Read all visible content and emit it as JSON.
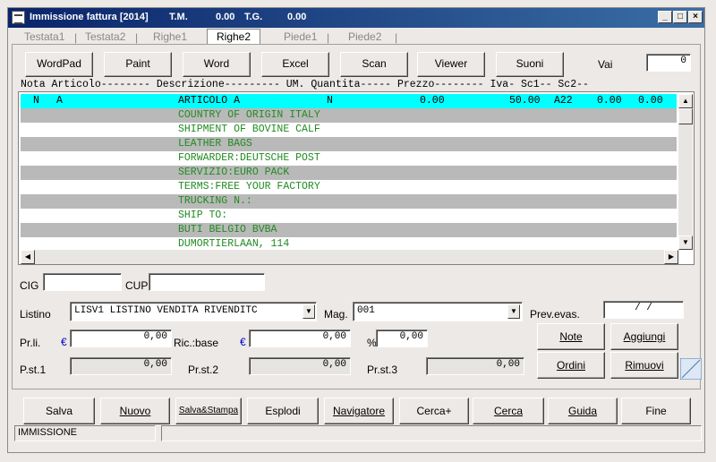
{
  "window": {
    "title_parts": [
      "Immissione fattura [2014]",
      "T.M.",
      "0.00",
      "T.G.",
      "0.00"
    ],
    "controls": {
      "minimize": "_",
      "maximize": "□",
      "close": "×"
    }
  },
  "tabs": [
    "Testata1",
    "Testata2",
    "Righe1",
    "Righe2",
    "Piede1",
    "Piede2"
  ],
  "active_tab": "Righe2",
  "toolbar": {
    "buttons": [
      "WordPad",
      "Paint",
      "Word",
      "Excel",
      "Scan",
      "Viewer",
      "Suoni"
    ],
    "vai_label": "Vai",
    "vai_value": "0"
  },
  "grid": {
    "header": "Nota Articolo-------- Descrizione--------- UM. Quantita----- Prezzo-------- Iva- Sc1-- Sc2--",
    "selected_row": {
      "nota": "N",
      "flag": "A",
      "descrizione": "ARTICOLO A",
      "um": "N",
      "quantita": "0.00",
      "prezzo": "50.00",
      "iva": "A22",
      "sc1": "0.00",
      "sc2": "0.00"
    },
    "rows": [
      "COUNTRY OF ORIGIN ITALY",
      "SHIPMENT OF BOVINE CALF",
      "LEATHER BAGS",
      "FORWARDER:DEUTSCHE POST",
      "SERVIZIO:EURO PACK",
      "TERMS:FREE YOUR FACTORY",
      "TRUCKING N.:",
      "SHIP TO:",
      "BUTI BELGIO BVBA",
      "DUMORTIERLAAN, 114"
    ]
  },
  "form": {
    "cig_label": "CIG",
    "cig_value": "",
    "cup_label": "CUP",
    "cup_value": "",
    "listino_label": "Listino",
    "listino_value": "LISV1  LISTINO VENDITA RIVENDITC",
    "mag_label": "Mag.",
    "mag_value": "001",
    "prev_evas_label": "Prev.evas.",
    "prev_evas_value": "/  /",
    "prli_label": "Pr.li.",
    "prli_currency": "€",
    "prli_value": "0,00",
    "ricbase_label": "Ric.:base",
    "ricbase_currency": "€",
    "ricbase_value": "0,00",
    "perc_label": "%",
    "perc_value": "0,00",
    "prst1_label": "P.st.1",
    "prst1_value": "0,00",
    "prst2_label": "Pr.st.2",
    "prst2_value": "0,00",
    "prst3_label": "Pr.st.3",
    "prst3_value": "0,00",
    "note_button": "Note",
    "aggiungi_button": "Aggiungi",
    "ordini_button": "Ordini",
    "rimuovi_button": "Rimuovi"
  },
  "bottom_buttons": [
    "Salva",
    "Nuovo",
    "Salva&Stampa",
    "Esplodi",
    "Navigatore",
    "Cerca+",
    "Cerca",
    "Guida",
    "Fine"
  ],
  "status": {
    "mode": "IMMISSIONE",
    "message": ""
  },
  "colors": {
    "title_start": "#0a246a",
    "title_end": "#3a6ea5",
    "selected_row": "#00ffff",
    "alt_row": "#b9b9b9",
    "desc_text": "#228b22",
    "euro": "#0000cc"
  }
}
